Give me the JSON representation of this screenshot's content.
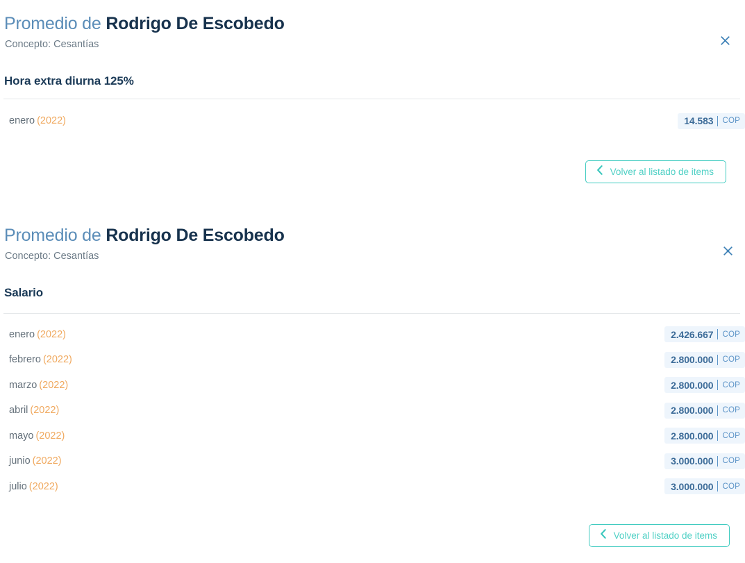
{
  "panels": [
    {
      "title_prefix": "Promedio de",
      "title_name": "Rodrigo De Escobedo",
      "subtitle": "Concepto: Cesantías",
      "close_icon": "close-icon",
      "section_title": "Hora extra diurna 125%",
      "back_button": {
        "label": "Volver al listado de items",
        "icon": "chevron-left-icon"
      },
      "rows": [
        {
          "month": "enero",
          "year": "(2022)",
          "amount": "14.583",
          "currency": "COP"
        }
      ]
    },
    {
      "title_prefix": "Promedio de",
      "title_name": "Rodrigo De Escobedo",
      "subtitle": "Concepto: Cesantías",
      "close_icon": "close-icon",
      "section_title": "Salario",
      "back_button": {
        "label": "Volver al listado de items",
        "icon": "chevron-left-icon"
      },
      "rows": [
        {
          "month": "enero",
          "year": "(2022)",
          "amount": "2.426.667",
          "currency": "COP"
        },
        {
          "month": "febrero",
          "year": "(2022)",
          "amount": "2.800.000",
          "currency": "COP"
        },
        {
          "month": "marzo",
          "year": "(2022)",
          "amount": "2.800.000",
          "currency": "COP"
        },
        {
          "month": "abril",
          "year": "(2022)",
          "amount": "2.800.000",
          "currency": "COP"
        },
        {
          "month": "mayo",
          "year": "(2022)",
          "amount": "2.800.000",
          "currency": "COP"
        },
        {
          "month": "junio",
          "year": "(2022)",
          "amount": "3.000.000",
          "currency": "COP"
        },
        {
          "month": "julio",
          "year": "(2022)",
          "amount": "3.000.000",
          "currency": "COP"
        }
      ]
    }
  ],
  "colors": {
    "title_prefix": "#5b8db8",
    "title_name": "#17324d",
    "year_accent": "#f0a95f",
    "badge_bg": "#eef5fc",
    "badge_amount": "#3d6c99",
    "badge_currency": "#5b93c7",
    "button_teal": "#40cbc0",
    "close_blue": "#3b7fb5",
    "divider": "#e4e7ea"
  }
}
